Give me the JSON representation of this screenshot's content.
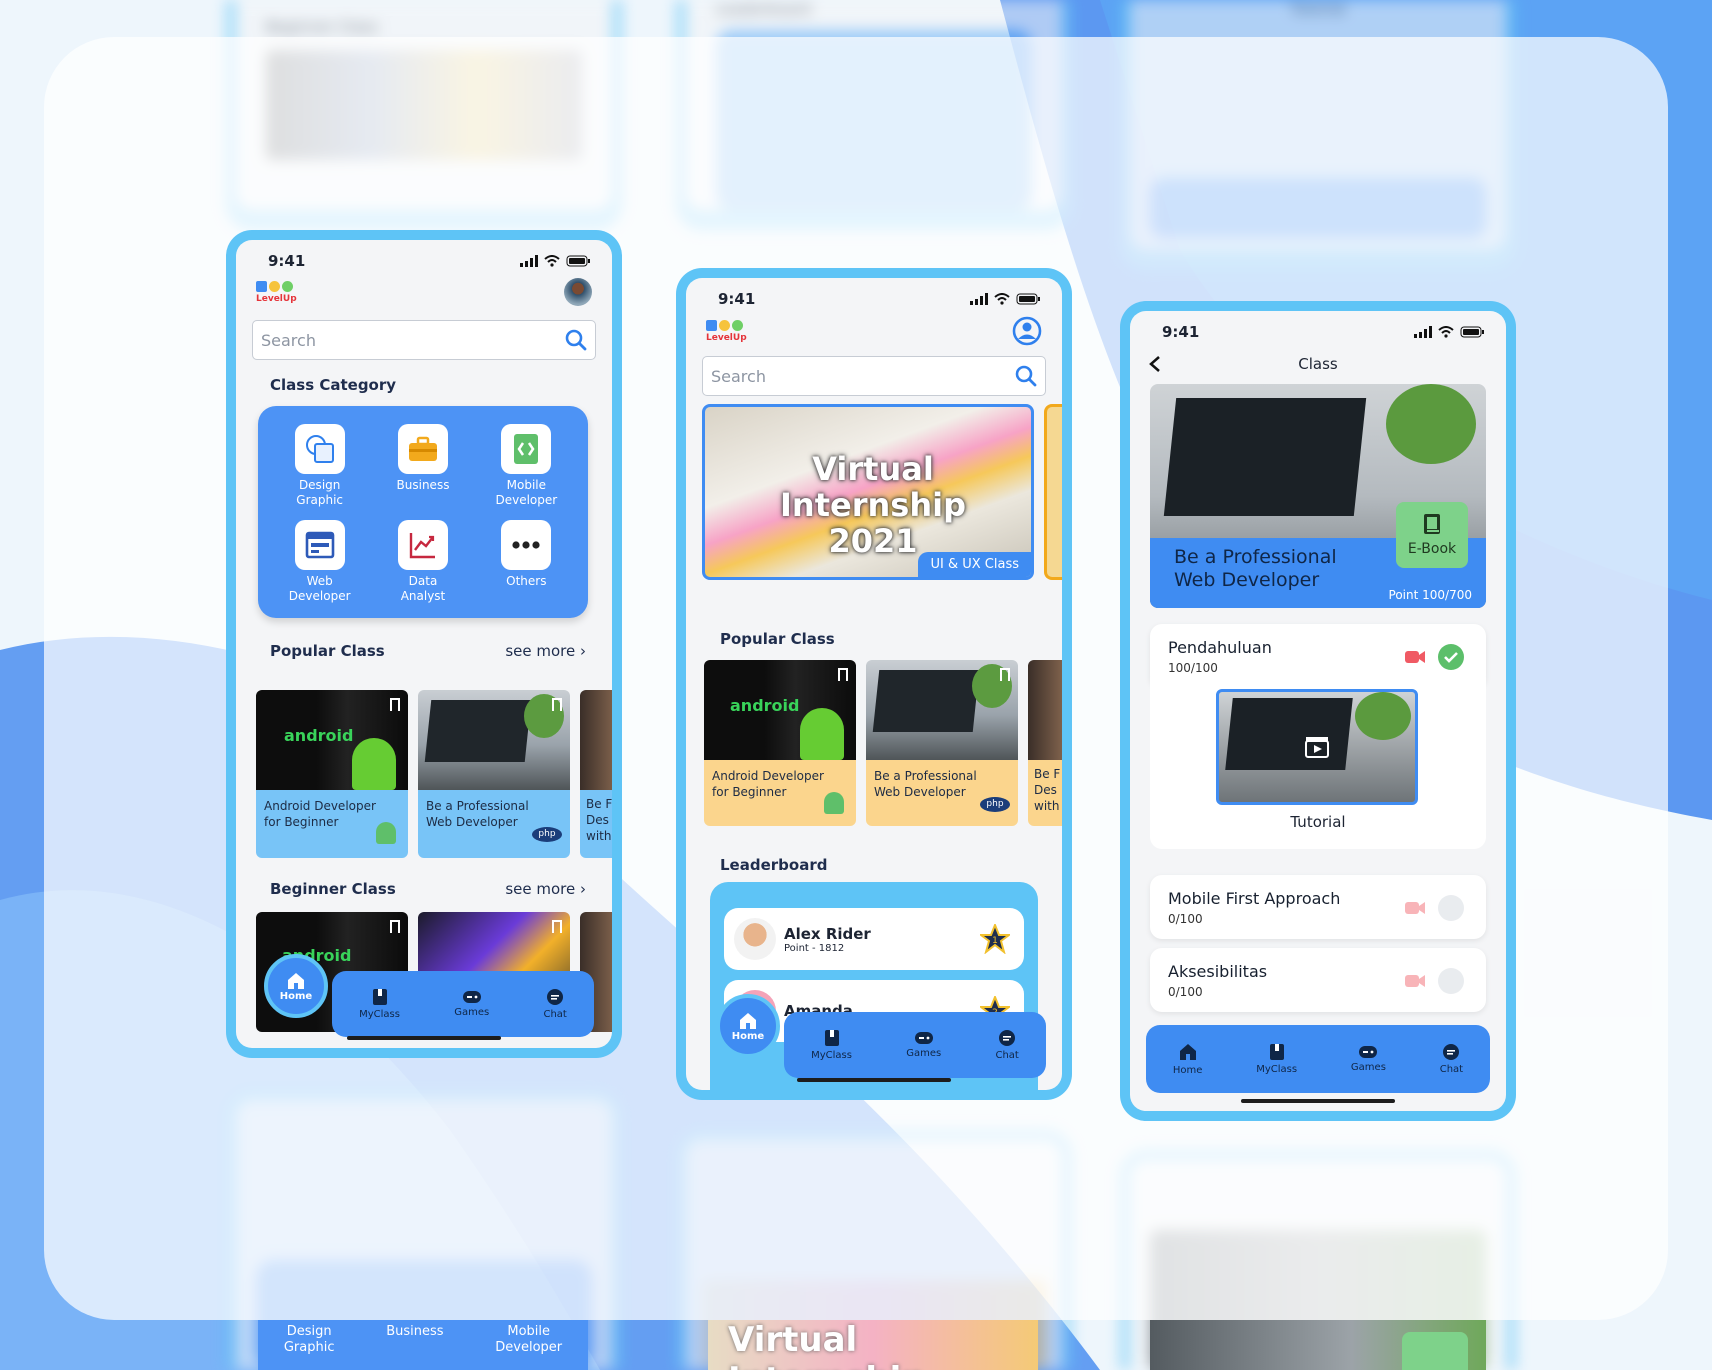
{
  "colors": {
    "primary": "#3f8cf2",
    "frame": "#5ec4f6",
    "card_blue": "#78c4f7",
    "card_yellow": "#fbd58d",
    "ebook_green": "#7ed28a"
  },
  "app": {
    "logo_text": "LevelUp",
    "status_time": "9:41"
  },
  "phone1": {
    "search_placeholder": "Search",
    "class_category": "Class Category",
    "categories": [
      {
        "label": "Design\nGraphic",
        "icon": "design-graphic-icon"
      },
      {
        "label": "Business",
        "icon": "briefcase-icon"
      },
      {
        "label": "Mobile\nDeveloper",
        "icon": "code-icon"
      },
      {
        "label": "Web\nDeveloper",
        "icon": "web-layout-icon"
      },
      {
        "label": "Data\nAnalyst",
        "icon": "line-chart-icon"
      },
      {
        "label": "Others",
        "icon": "more-dots-icon"
      }
    ],
    "popular_class": "Popular Class",
    "beginner_class": "Beginner Class",
    "see_more": "see more ›",
    "courses": [
      {
        "title": "Android Developer\nfor Beginner"
      },
      {
        "title": "Be a Professional\nWeb Developer"
      },
      {
        "title": "Be F\nDes\nwith"
      }
    ]
  },
  "phone2": {
    "search_placeholder": "Search",
    "banner_title": "Virtual Internship\n2021",
    "banner_tag": "UI & UX Class",
    "popular_class": "Popular Class",
    "courses": [
      {
        "title": "Android Developer\nfor Beginner"
      },
      {
        "title": "Be a Professional\nWeb Developer"
      },
      {
        "title": "Be F\nDes\nwith"
      }
    ],
    "leaderboard": "Leaderboard",
    "leaders": [
      {
        "name": "Alex Rider",
        "points": "Point - 1812",
        "rank": "1"
      },
      {
        "name": "Amanda",
        "points": "",
        "rank": "2"
      }
    ]
  },
  "phone3": {
    "header": "Class",
    "hero_title": "Be a Professional\nWeb Developer",
    "hero_points": "Point 100/700",
    "ebook": "E-Book",
    "lessons": [
      {
        "title": "Pendahuluan",
        "progress": "100/100",
        "done": true
      },
      {
        "title": "Mobile First Approach",
        "progress": "0/100",
        "done": false
      },
      {
        "title": "Aksesibilitas",
        "progress": "0/100",
        "done": false
      }
    ],
    "tutorial_label": "Tutorial"
  },
  "nav": {
    "home": "Home",
    "myclass": "MyClass",
    "games": "Games",
    "chat": "Chat"
  },
  "ghosts": {
    "beginner_top": "Beginner Class",
    "leaderboard_top": "Leaderboard",
    "tutorial_top": "Tutorial",
    "design_graphic": "Design\nGraphic",
    "business": "Business",
    "mobile_developer": "Mobile\nDeveloper",
    "banner_bottom": "Virtual Internship"
  }
}
